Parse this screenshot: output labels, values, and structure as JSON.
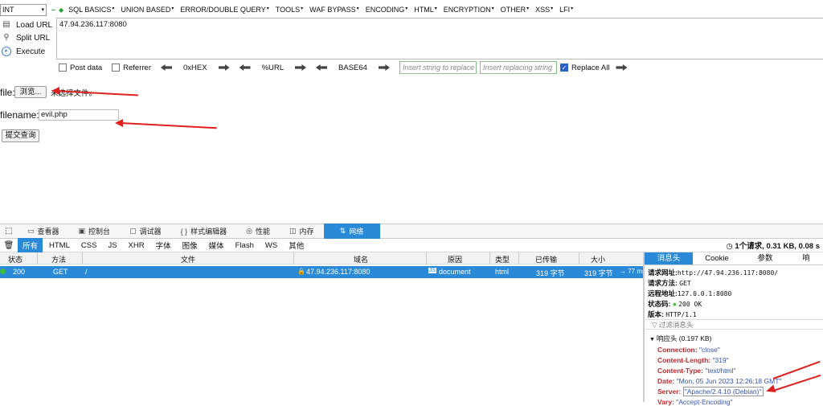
{
  "hackbar": {
    "int_select": "INT",
    "menus": [
      "SQL BASICS",
      "UNION BASED",
      "ERROR/DOUBLE QUERY",
      "TOOLS",
      "WAF BYPASS",
      "ENCODING",
      "HTML",
      "ENCRYPTION",
      "OTHER",
      "XSS",
      "LFI"
    ],
    "actions": {
      "load": "Load URL",
      "split": "Split URL",
      "execute": "Execute"
    },
    "url_value": "47.94.236.117:8080",
    "options": {
      "post_data": "Post data",
      "referrer": "Referrer",
      "hex": "0xHEX",
      "url": "%URL",
      "base64": "BASE64",
      "replace_placeholder": "Insert string to replace",
      "replacing_placeholder": "Insert replacing string",
      "replace_all": "Replace All"
    }
  },
  "page": {
    "file_label": "file:",
    "browse_button": "浏览...",
    "no_file_text": "未选择文件。",
    "filename_label": "filename:",
    "filename_value": "evil.php",
    "submit_button": "提交查询"
  },
  "devtools": {
    "tabs": [
      {
        "label": "查看器",
        "icon": "inspector-icon"
      },
      {
        "label": "控制台",
        "icon": "console-icon"
      },
      {
        "label": "调试器",
        "icon": "debugger-icon"
      },
      {
        "label": "样式编辑器",
        "icon": "style-editor-icon"
      },
      {
        "label": "性能",
        "icon": "performance-icon"
      },
      {
        "label": "内存",
        "icon": "memory-icon"
      },
      {
        "label": "网络",
        "icon": "network-icon"
      }
    ],
    "filters": [
      "所有",
      "HTML",
      "CSS",
      "JS",
      "XHR",
      "字体",
      "图像",
      "媒体",
      "Flash",
      "WS",
      "其他"
    ],
    "summary": "1个请求, 0.31 KB, 0.08 s",
    "columns": [
      "状态",
      "方法",
      "文件",
      "域名",
      "原因",
      "类型",
      "已传输",
      "大小"
    ],
    "request": {
      "status": "200",
      "method": "GET",
      "file": "/",
      "domain": "47.94.236.117:8080",
      "cause": "document",
      "type": "html",
      "transferred": "319 字节",
      "size": "319 字节",
      "time": "→ 77 ms"
    },
    "detail": {
      "tabs": [
        "消息头",
        "Cookie",
        "参数",
        "响"
      ],
      "request_url_label": "请求网址:",
      "request_url": "http://47.94.236.117:8080/",
      "method_label": "请求方法:",
      "method": "GET",
      "remote_label": "远程地址:",
      "remote": "127.0.0.1:8080",
      "status_label": "状态码:",
      "status": "200 OK",
      "version_label": "版本:",
      "version": "HTTP/1.1",
      "filter_placeholder": "过滤消息头",
      "response_headers_title": "响应头 (0.197 KB)",
      "headers": [
        {
          "name": "Connection:",
          "value": "\"close\""
        },
        {
          "name": "Content-Length:",
          "value": "\"319\""
        },
        {
          "name": "Content-Type:",
          "value": "\"text/html\""
        },
        {
          "name": "Date:",
          "value": "\"Mon, 05 Jun 2023 12:26:18 GMT\""
        },
        {
          "name": "Server:",
          "value": "\"Apache/2.4.10 (Debian)\""
        },
        {
          "name": "Vary:",
          "value": "\"Accept-Encoding\""
        }
      ]
    }
  },
  "colors": {
    "accent": "#2a8ad8",
    "annotation": "#e02020"
  }
}
